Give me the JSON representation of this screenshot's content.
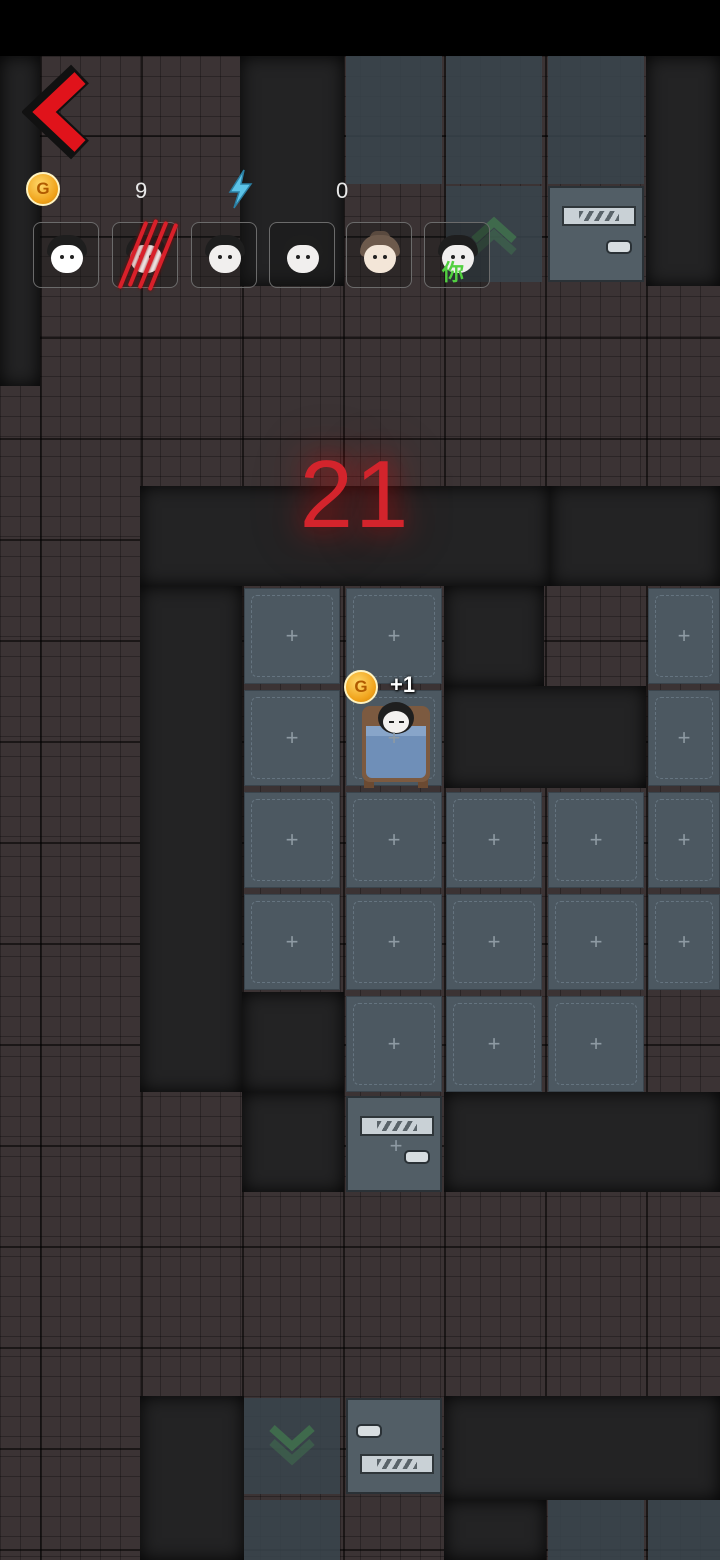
{
  "timer": {
    "value": "21"
  },
  "resources": {
    "gold": {
      "value": "9",
      "icon": "gold-coin-icon",
      "coin_letter": "G"
    },
    "energy": {
      "value": "0",
      "icon": "lightning-icon"
    }
  },
  "player_slots": [
    {
      "icon": "ghost-girl-avatar-icon"
    },
    {
      "icon": "clawed-avatar-icon"
    },
    {
      "icon": "girl-avatar-icon"
    },
    {
      "icon": "girl-avatar-icon"
    },
    {
      "icon": "bun-hair-avatar-icon"
    },
    {
      "icon": "self-avatar-icon",
      "tag": "你"
    }
  ],
  "player": {
    "gain": "+1",
    "coin_letter": "G"
  },
  "colors": {
    "timer": "#d3242c",
    "accent_red": "#e0131b",
    "gold": "#f0a21a",
    "you_tag": "#52d040",
    "tile": "#4c5861"
  },
  "tile_symbol": "+"
}
